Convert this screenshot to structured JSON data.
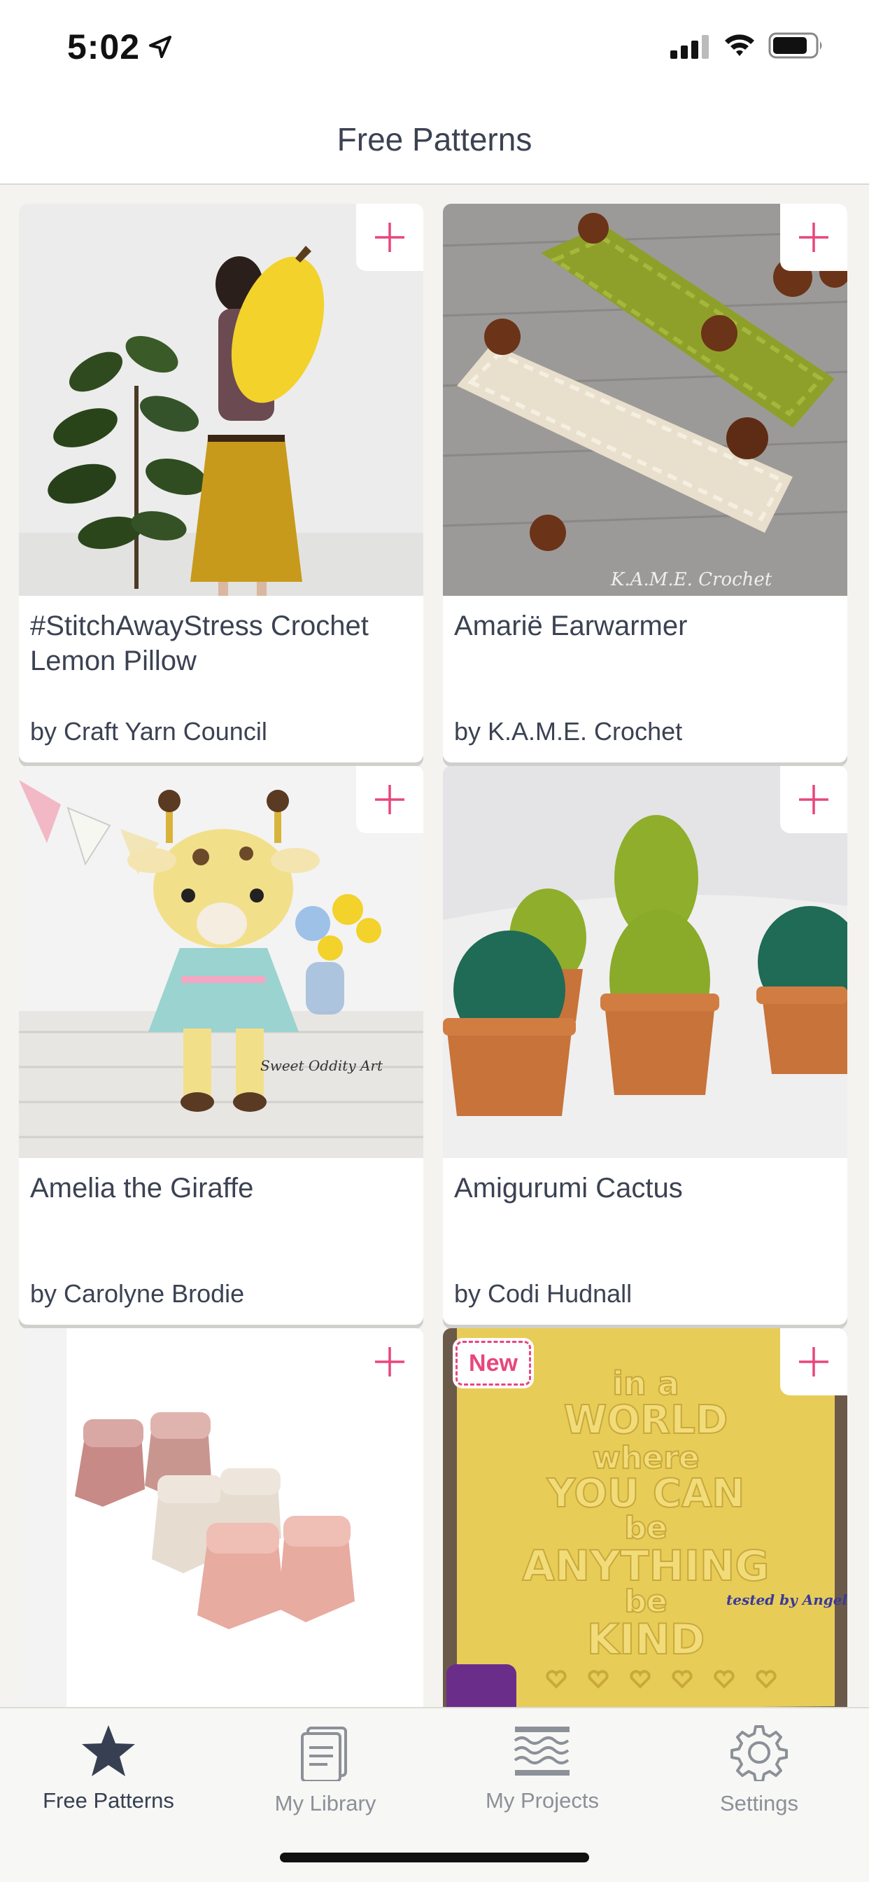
{
  "status_bar": {
    "time": "5:02"
  },
  "header": {
    "title": "Free Patterns"
  },
  "patterns": [
    {
      "title": "#StitchAwayStress Crochet Lemon Pillow",
      "author": "by Craft Yarn Council",
      "is_new": false
    },
    {
      "title": "Amarië Earwarmer",
      "author": "by K.A.M.E. Crochet",
      "is_new": false,
      "image_watermark": "K.A.M.E. Crochet"
    },
    {
      "title": "Amelia the Giraffe",
      "author": "by Carolyne Brodie",
      "is_new": false,
      "image_watermark": "Sweet Oddity Art"
    },
    {
      "title": "Amigurumi Cactus",
      "author": "by Codi Hudnall",
      "is_new": false
    },
    {
      "title": "",
      "author": "",
      "is_new": false
    },
    {
      "title": "",
      "author": "",
      "is_new": true,
      "badge": "New",
      "image_text": [
        "in a",
        "WORLD",
        "where",
        "YOU CAN",
        "be",
        "ANYTHING",
        "be",
        "KIND"
      ],
      "image_signature": "tested by Angela Hursh"
    }
  ],
  "tab_bar": {
    "tabs": [
      {
        "label": "Free Patterns",
        "icon": "star-icon",
        "active": true
      },
      {
        "label": "My Library",
        "icon": "library-icon",
        "active": false
      },
      {
        "label": "My Projects",
        "icon": "yarn-icon",
        "active": false
      },
      {
        "label": "Settings",
        "icon": "gear-icon",
        "active": false
      }
    ]
  },
  "colors": {
    "accent": "#e8467c",
    "background": "#f4f3ef",
    "text": "#3b4252",
    "tab_inactive": "#8c9098"
  }
}
